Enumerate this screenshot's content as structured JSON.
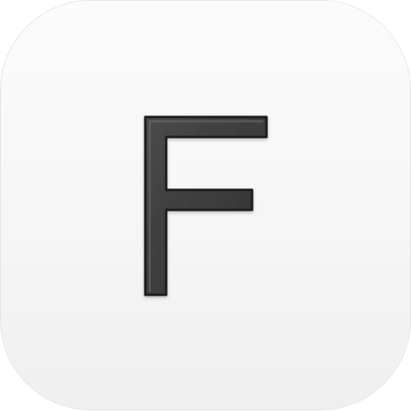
{
  "app_icon": {
    "letter": "F",
    "tile_color": "#f6f6f6",
    "letter_color": "#3a3a3a",
    "letter_edge_color": "#1e1e1e"
  }
}
